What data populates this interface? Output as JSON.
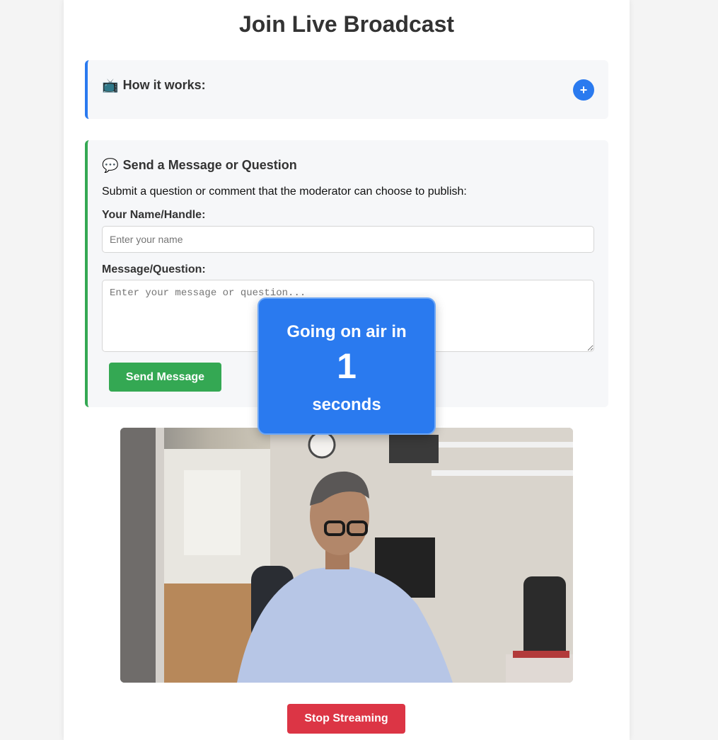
{
  "page": {
    "title": "Join Live Broadcast"
  },
  "how_it_works": {
    "icon": "tv-icon",
    "icon_glyph": "📺",
    "heading": "How it works:",
    "expand_label": "+",
    "accent": "#2a7aef"
  },
  "message_panel": {
    "icon": "speech-bubble-icon",
    "icon_glyph": "💬",
    "heading": "Send a Message or Question",
    "description": "Submit a question or comment that the moderator can choose to publish:",
    "name_label": "Your Name/Handle:",
    "name_placeholder": "Enter your name",
    "name_value": "",
    "message_label": "Message/Question:",
    "message_placeholder": "Enter your message or question...",
    "message_value": "",
    "send_label": "Send Message",
    "accent": "#34a853"
  },
  "countdown": {
    "prefix": "Going on air in",
    "value": "1",
    "suffix": "seconds",
    "color": "#2a7aef"
  },
  "video": {
    "description_icon": "webcam-video-feed"
  },
  "controls": {
    "stop_label": "Stop Streaming",
    "stop_color": "#dc3545"
  }
}
